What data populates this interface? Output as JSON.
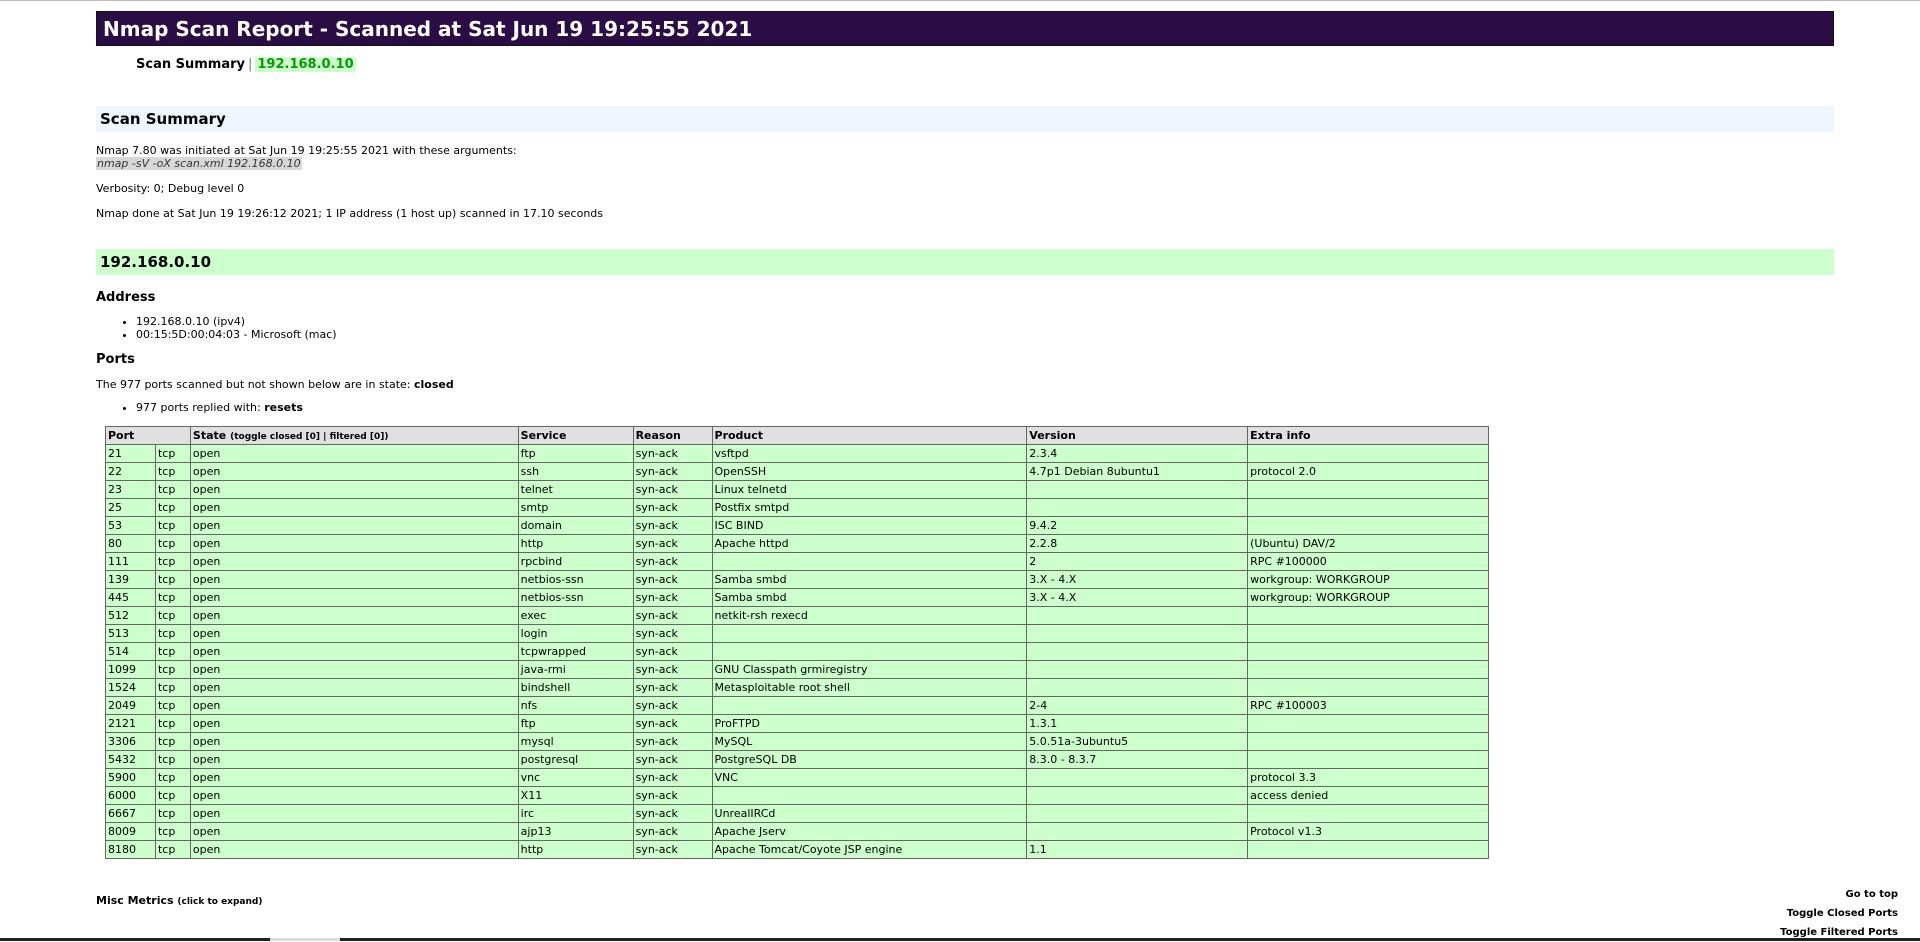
{
  "report": {
    "title": "Nmap Scan Report - Scanned at Sat Jun 19 19:25:55 2021",
    "menu": {
      "summary_link": "Scan Summary",
      "separator": "|",
      "host_link": "192.168.0.10"
    }
  },
  "summary": {
    "heading": "Scan Summary",
    "initiated": "Nmap 7.80 was initiated at Sat Jun 19 19:25:55 2021 with these arguments:",
    "command": "nmap -sV -oX scan.xml 192.168.0.10",
    "verbosity": "Verbosity: 0; Debug level 0",
    "done": "Nmap done at Sat Jun 19 19:26:12 2021; 1 IP address (1 host up) scanned in 17.10 seconds"
  },
  "host": {
    "heading": "192.168.0.10",
    "address_heading": "Address",
    "addresses": [
      "192.168.0.10 (ipv4)",
      "00:15:5D:00:04:03 - Microsoft (mac)"
    ],
    "ports_heading": "Ports",
    "closed_text": "The 977 ports scanned but not shown below are in state:",
    "closed_state": "closed",
    "extra_text": "977 ports replied with:",
    "extra_reason": "resets"
  },
  "ports_table": {
    "headers": {
      "port": "Port",
      "state": "State",
      "state_toggle": "(toggle closed [0] | filtered [0])",
      "service": "Service",
      "reason": "Reason",
      "product": "Product",
      "version": "Version",
      "extra": "Extra info"
    },
    "rows": [
      [
        "21",
        "tcp",
        "open",
        "ftp",
        "syn-ack",
        "vsftpd",
        "2.3.4",
        ""
      ],
      [
        "22",
        "tcp",
        "open",
        "ssh",
        "syn-ack",
        "OpenSSH",
        "4.7p1 Debian 8ubuntu1",
        "protocol 2.0"
      ],
      [
        "23",
        "tcp",
        "open",
        "telnet",
        "syn-ack",
        "Linux telnetd",
        "",
        ""
      ],
      [
        "25",
        "tcp",
        "open",
        "smtp",
        "syn-ack",
        "Postfix smtpd",
        "",
        ""
      ],
      [
        "53",
        "tcp",
        "open",
        "domain",
        "syn-ack",
        "ISC BIND",
        "9.4.2",
        ""
      ],
      [
        "80",
        "tcp",
        "open",
        "http",
        "syn-ack",
        "Apache httpd",
        "2.2.8",
        "(Ubuntu) DAV/2"
      ],
      [
        "111",
        "tcp",
        "open",
        "rpcbind",
        "syn-ack",
        "",
        "2",
        "RPC #100000"
      ],
      [
        "139",
        "tcp",
        "open",
        "netbios-ssn",
        "syn-ack",
        "Samba smbd",
        "3.X - 4.X",
        "workgroup: WORKGROUP"
      ],
      [
        "445",
        "tcp",
        "open",
        "netbios-ssn",
        "syn-ack",
        "Samba smbd",
        "3.X - 4.X",
        "workgroup: WORKGROUP"
      ],
      [
        "512",
        "tcp",
        "open",
        "exec",
        "syn-ack",
        "netkit-rsh rexecd",
        "",
        ""
      ],
      [
        "513",
        "tcp",
        "open",
        "login",
        "syn-ack",
        "",
        "",
        ""
      ],
      [
        "514",
        "tcp",
        "open",
        "tcpwrapped",
        "syn-ack",
        "",
        "",
        ""
      ],
      [
        "1099",
        "tcp",
        "open",
        "java-rmi",
        "syn-ack",
        "GNU Classpath grmiregistry",
        "",
        ""
      ],
      [
        "1524",
        "tcp",
        "open",
        "bindshell",
        "syn-ack",
        "Metasploitable root shell",
        "",
        ""
      ],
      [
        "2049",
        "tcp",
        "open",
        "nfs",
        "syn-ack",
        "",
        "2-4",
        "RPC #100003"
      ],
      [
        "2121",
        "tcp",
        "open",
        "ftp",
        "syn-ack",
        "ProFTPD",
        "1.3.1",
        ""
      ],
      [
        "3306",
        "tcp",
        "open",
        "mysql",
        "syn-ack",
        "MySQL",
        "5.0.51a-3ubuntu5",
        ""
      ],
      [
        "5432",
        "tcp",
        "open",
        "postgresql",
        "syn-ack",
        "PostgreSQL DB",
        "8.3.0 - 8.3.7",
        ""
      ],
      [
        "5900",
        "tcp",
        "open",
        "vnc",
        "syn-ack",
        "VNC",
        "",
        "protocol 3.3"
      ],
      [
        "6000",
        "tcp",
        "open",
        "X11",
        "syn-ack",
        "",
        "",
        "access denied"
      ],
      [
        "6667",
        "tcp",
        "open",
        "irc",
        "syn-ack",
        "UnrealIRCd",
        "",
        ""
      ],
      [
        "8009",
        "tcp",
        "open",
        "ajp13",
        "syn-ack",
        "Apache Jserv",
        "",
        "Protocol v1.3"
      ],
      [
        "8180",
        "tcp",
        "open",
        "http",
        "syn-ack",
        "Apache Tomcat/Coyote JSP engine",
        "1.1",
        ""
      ]
    ]
  },
  "footer": {
    "misc_label": "Misc Metrics",
    "misc_hint": "(click to expand)",
    "go_top": "Go to top",
    "toggle_closed": "Toggle Closed Ports",
    "toggle_filtered": "Toggle Filtered Ports"
  }
}
